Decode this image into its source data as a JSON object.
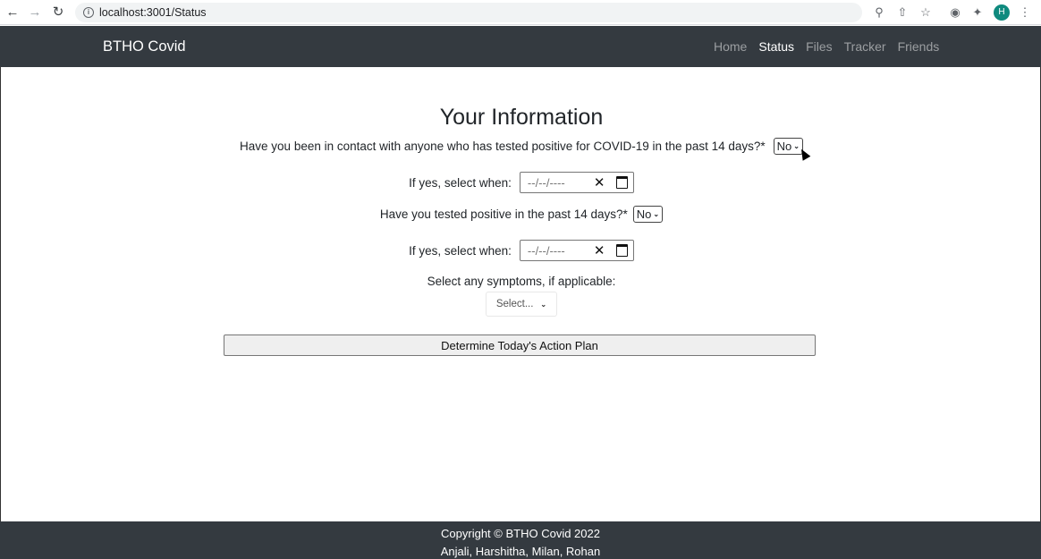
{
  "browser": {
    "url": "localhost:3001/Status",
    "back_icon": "arrow-left-icon",
    "forward_icon": "arrow-right-icon",
    "reload_icon": "reload-icon",
    "avatar_letter": "H"
  },
  "navbar": {
    "brand": "BTHO Covid",
    "links": [
      {
        "label": "Home",
        "active": false
      },
      {
        "label": "Status",
        "active": true
      },
      {
        "label": "Files",
        "active": false
      },
      {
        "label": "Tracker",
        "active": false
      },
      {
        "label": "Friends",
        "active": false
      }
    ]
  },
  "form": {
    "title": "Your Information",
    "contact_question": "Have you been in contact with anyone who has tested positive for COVID-19 in the past 14 days?*",
    "contact_value": "No",
    "contact_date_label": "If yes, select when:",
    "contact_date_placeholder": "--/--/----",
    "positive_question": "Have you tested positive in the past 14 days?*",
    "positive_value": "No",
    "positive_date_label": "If yes, select when:",
    "positive_date_placeholder": "--/--/----",
    "symptoms_label": "Select any symptoms, if applicable:",
    "symptoms_placeholder": "Select...",
    "action_button": "Determine Today's Action Plan"
  },
  "footer": {
    "copyright": "Copyright © BTHO Covid 2022",
    "authors": "Anjali, Harshitha, Milan, Rohan"
  },
  "colors": {
    "navbar_bg": "#343a40",
    "avatar_bg": "#0f8a7e"
  }
}
